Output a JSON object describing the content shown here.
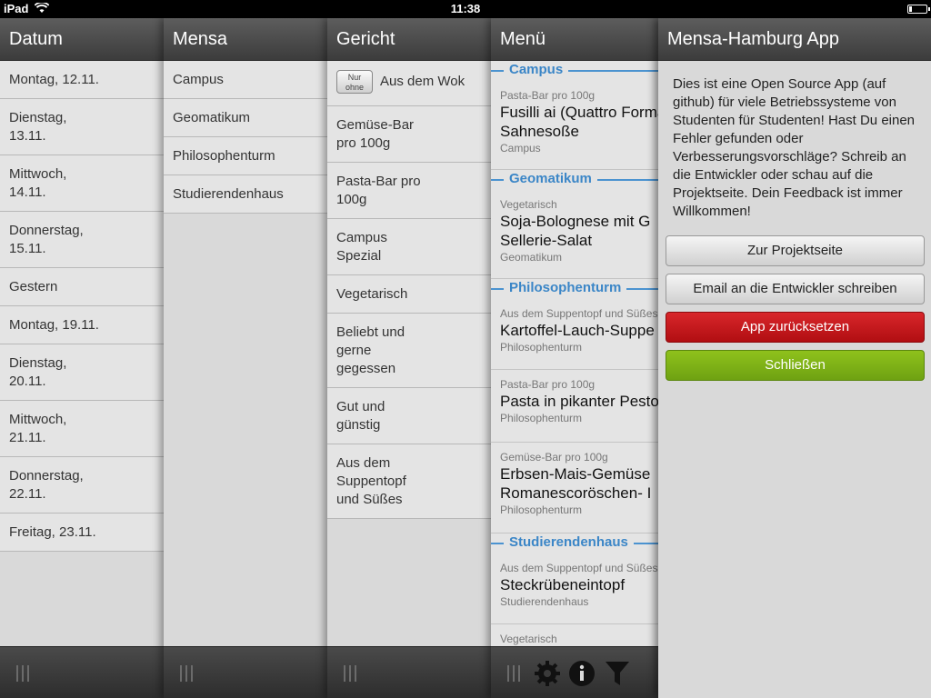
{
  "status_bar": {
    "carrier": "iPad",
    "time": "11:38"
  },
  "datum": {
    "title": "Datum",
    "items": [
      {
        "l1": "Montag, 12.11.",
        "l2": ""
      },
      {
        "l1": "Dienstag,",
        "l2": "13.11."
      },
      {
        "l1": "Mittwoch,",
        "l2": "14.11."
      },
      {
        "l1": "Donnerstag,",
        "l2": "15.11."
      },
      {
        "l1": "Gestern",
        "l2": ""
      },
      {
        "l1": "Montag, 19.11.",
        "l2": ""
      },
      {
        "l1": "Dienstag,",
        "l2": "20.11."
      },
      {
        "l1": "Mittwoch,",
        "l2": "21.11."
      },
      {
        "l1": "Donnerstag,",
        "l2": "22.11."
      },
      {
        "l1": "Freitag, 23.11.",
        "l2": ""
      }
    ]
  },
  "mensa": {
    "title": "Mensa",
    "items": [
      "Campus",
      "Geomatikum",
      "Philosophenturm",
      "Studierendenhaus"
    ]
  },
  "gericht": {
    "title": "Gericht",
    "badge_l1": "Nur",
    "badge_l2": "ohne",
    "items": [
      {
        "l1": "Aus dem Wok",
        "l2": "",
        "l3": ""
      },
      {
        "l1": "Gemüse-Bar",
        "l2": "pro 100g",
        "l3": ""
      },
      {
        "l1": "Pasta-Bar pro",
        "l2": "100g",
        "l3": ""
      },
      {
        "l1": "Campus",
        "l2": "Spezial",
        "l3": ""
      },
      {
        "l1": "Vegetarisch",
        "l2": "",
        "l3": ""
      },
      {
        "l1": "Beliebt und",
        "l2": "gerne",
        "l3": "gegessen"
      },
      {
        "l1": "Gut und",
        "l2": "günstig",
        "l3": ""
      },
      {
        "l1": "Aus dem",
        "l2": "Suppentopf",
        "l3": "und Süßes"
      }
    ]
  },
  "menu": {
    "title": "Menü",
    "sections": {
      "campus": "Campus",
      "geomatikum": "Geomatikum",
      "philosophenturm": "Philosophenturm",
      "studierendenhaus": "Studierendenhaus"
    },
    "dishes": [
      {
        "cat": "Pasta-Bar pro 100g",
        "n1": "Fusilli ai (Quattro Formaggi)",
        "n2": "Sahnesoße",
        "loc": "Campus"
      },
      {
        "cat": "Vegetarisch",
        "n1": "Soja-Bolognese mit G",
        "n2": "Sellerie-Salat",
        "loc": "Geomatikum"
      },
      {
        "cat": "Aus dem Suppentopf und Süßes",
        "n1": "Kartoffel-Lauch-Suppe",
        "n2": "",
        "loc": "Philosophenturm"
      },
      {
        "cat": "Pasta-Bar pro 100g",
        "n1": "Pasta in pikanter Pesto",
        "n2": "",
        "loc": "Philosophenturm"
      },
      {
        "cat": "Gemüse-Bar pro 100g",
        "n1": "Erbsen-Mais-Gemüse",
        "n2": "Romanescoröschen- I",
        "loc": "Philosophenturm"
      },
      {
        "cat": "Aus dem Suppentopf und Süßes",
        "n1": "Steckrübeneintopf",
        "n2": "",
        "loc": "Studierendenhaus"
      },
      {
        "cat": "Vegetarisch",
        "n1": "",
        "n2": "",
        "loc": ""
      }
    ]
  },
  "info": {
    "title": "Mensa-Hamburg App",
    "text": "Dies ist eine Open Source App (auf github) für viele Betriebssysteme von Studenten für Studenten! Hast Du einen Fehler gefunden oder Verbesserungsvorschläge? Schreib an die Entwickler oder schau auf die Projektseite. Dein Feedback ist immer Willkommen!",
    "btn_project": "Zur Projektseite",
    "btn_email": "Email an die Entwickler schreiben",
    "btn_reset": "App zurücksetzen",
    "btn_close": "Schließen"
  },
  "colors": {
    "accent": "#3b86c7",
    "danger": "#c4151a",
    "success": "#7fb217"
  },
  "icons": [
    "wifi-icon",
    "battery-icon",
    "grip-icon",
    "gear-icon",
    "info-icon",
    "filter-icon"
  ]
}
